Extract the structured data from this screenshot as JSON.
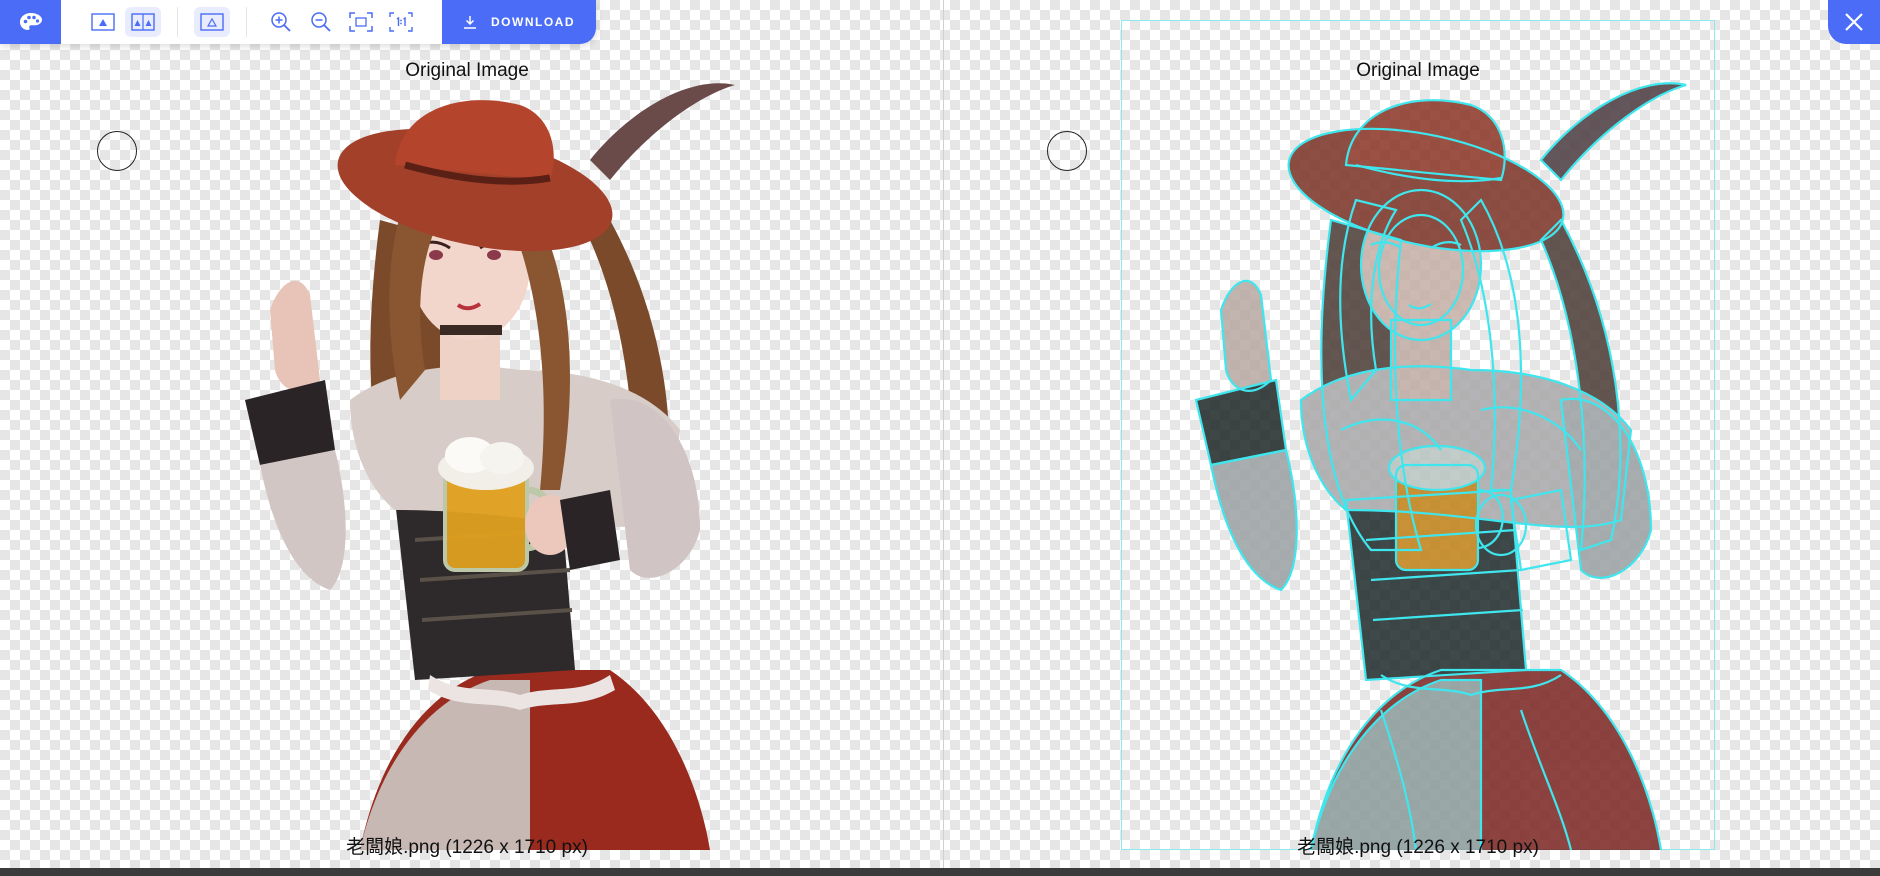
{
  "toolbar": {
    "download_label": "DOWNLOAD",
    "tools": [
      {
        "name": "palette-icon"
      },
      {
        "name": "single-view-icon"
      },
      {
        "name": "side-by-side-view-icon"
      },
      {
        "name": "outline-view-icon"
      },
      {
        "name": "zoom-in-icon"
      },
      {
        "name": "zoom-out-icon"
      },
      {
        "name": "fit-to-screen-icon"
      },
      {
        "name": "actual-size-icon"
      }
    ]
  },
  "left_panel": {
    "title": "Original Image",
    "caption": "老闆娘.png (1226 x 1710 px)"
  },
  "right_panel": {
    "title": "Original Image",
    "caption": "老闆娘.png (1226 x 1710 px)"
  },
  "colors": {
    "accent": "#4a6cf7",
    "outline": "#3fe6ee"
  }
}
